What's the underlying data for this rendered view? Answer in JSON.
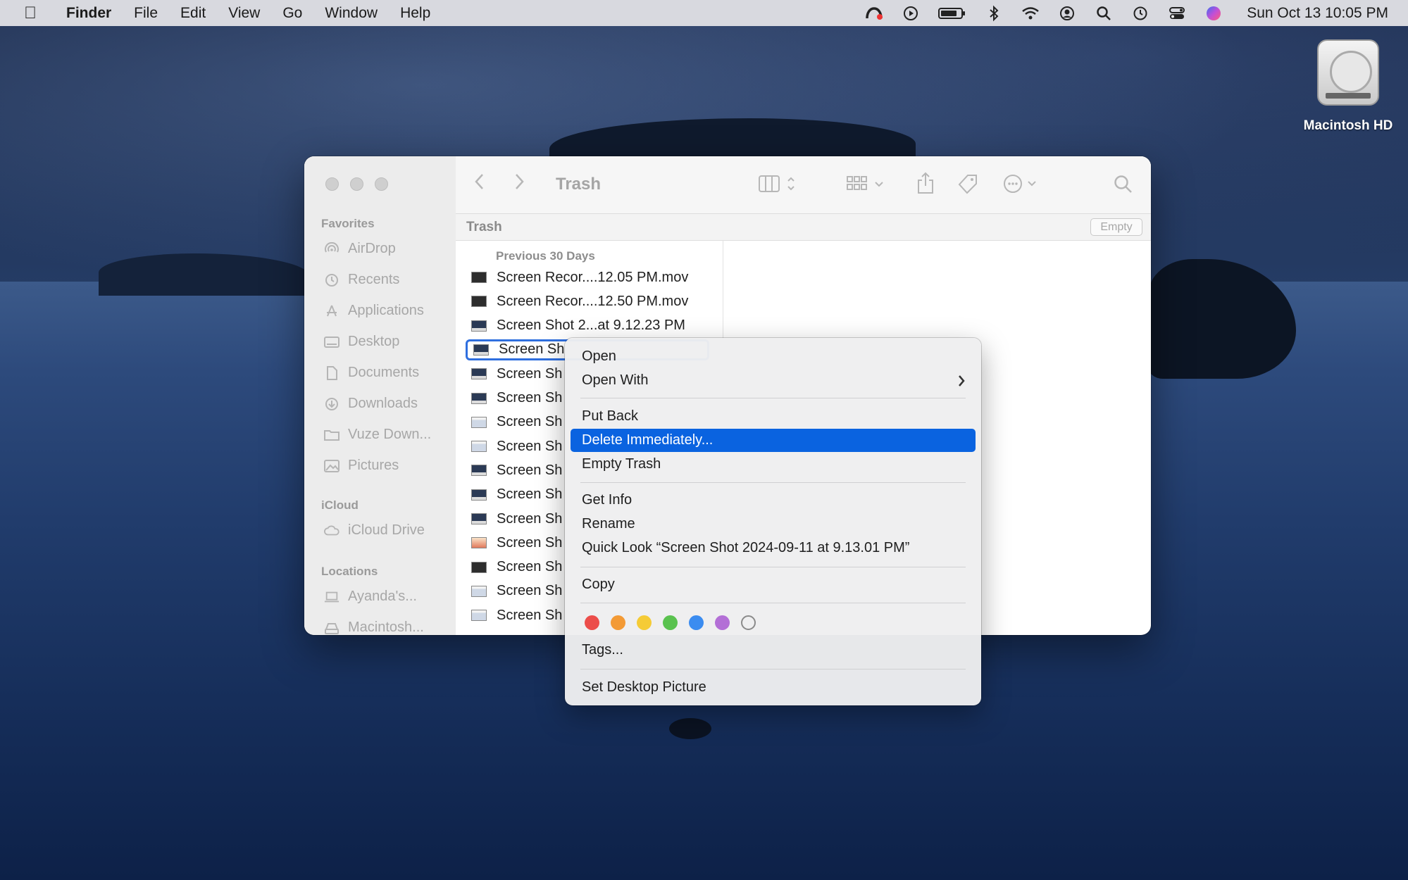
{
  "menubar": {
    "apple_icon": "apple-logo-icon",
    "app_name": "Finder",
    "items": [
      "File",
      "Edit",
      "View",
      "Go",
      "Window",
      "Help"
    ],
    "clock": "Sun Oct 13  10:05 PM",
    "status_icons": [
      "creative-cloud-icon",
      "play-icon",
      "battery-icon",
      "bluetooth-icon",
      "wifi-icon",
      "user-icon",
      "spotlight-search-icon",
      "time-machine-icon",
      "control-center-icon",
      "siri-icon"
    ]
  },
  "desktop": {
    "disk_label": "Macintosh HD"
  },
  "window": {
    "title": "Trash",
    "path_title": "Trash",
    "empty_button": "Empty",
    "sidebar": {
      "favorites_heading": "Favorites",
      "favorites": [
        {
          "label": "AirDrop",
          "icon": "airdrop-icon"
        },
        {
          "label": "Recents",
          "icon": "clock-icon"
        },
        {
          "label": "Applications",
          "icon": "applications-icon"
        },
        {
          "label": "Desktop",
          "icon": "desktop-icon"
        },
        {
          "label": "Documents",
          "icon": "document-icon"
        },
        {
          "label": "Downloads",
          "icon": "download-icon"
        },
        {
          "label": "Vuze Down...",
          "icon": "folder-icon"
        },
        {
          "label": "Pictures",
          "icon": "pictures-icon"
        }
      ],
      "icloud_heading": "iCloud",
      "icloud": [
        {
          "label": "iCloud Drive",
          "icon": "cloud-icon"
        }
      ],
      "locations_heading": "Locations",
      "locations": [
        {
          "label": "Ayanda's...",
          "icon": "laptop-icon"
        },
        {
          "label": "Macintosh...",
          "icon": "disk-icon"
        }
      ]
    },
    "column": {
      "header": "Previous 30 Days",
      "files": [
        {
          "name": "Screen Recor....12.05 PM.mov",
          "thumb": "dark"
        },
        {
          "name": "Screen Recor....12.50 PM.mov",
          "thumb": "dark"
        },
        {
          "name": "Screen Shot 2...at 9.12.23 PM",
          "thumb": "default"
        },
        {
          "name": "Screen Sh",
          "thumb": "default"
        },
        {
          "name": "Screen Sh",
          "thumb": "default"
        },
        {
          "name": "Screen Sh",
          "thumb": "default"
        },
        {
          "name": "Screen Sh",
          "thumb": "light"
        },
        {
          "name": "Screen Sh",
          "thumb": "light"
        },
        {
          "name": "Screen Sh",
          "thumb": "default"
        },
        {
          "name": "Screen Sh",
          "thumb": "default"
        },
        {
          "name": "Screen Sh",
          "thumb": "default"
        },
        {
          "name": "Screen Sh",
          "thumb": "warm"
        },
        {
          "name": "Screen Sh",
          "thumb": "dark"
        },
        {
          "name": "Screen Sh",
          "thumb": "light"
        },
        {
          "name": "Screen Sh",
          "thumb": "light"
        }
      ],
      "selected_index": 3
    }
  },
  "context_menu": {
    "items": {
      "open": "Open",
      "open_with": "Open With",
      "put_back": "Put Back",
      "delete_immediately": "Delete Immediately...",
      "empty_trash": "Empty Trash",
      "get_info": "Get Info",
      "rename": "Rename",
      "quick_look": "Quick Look “Screen Shot 2024-09-11 at 9.13.01 PM”",
      "copy": "Copy",
      "tags": "Tags...",
      "set_desktop_picture": "Set Desktop Picture"
    },
    "highlighted": "delete_immediately",
    "tag_colors": [
      "#ec4d4a",
      "#f39a35",
      "#f5cb36",
      "#5ac24f",
      "#3b8cf0",
      "#b36fd6",
      "none"
    ]
  }
}
